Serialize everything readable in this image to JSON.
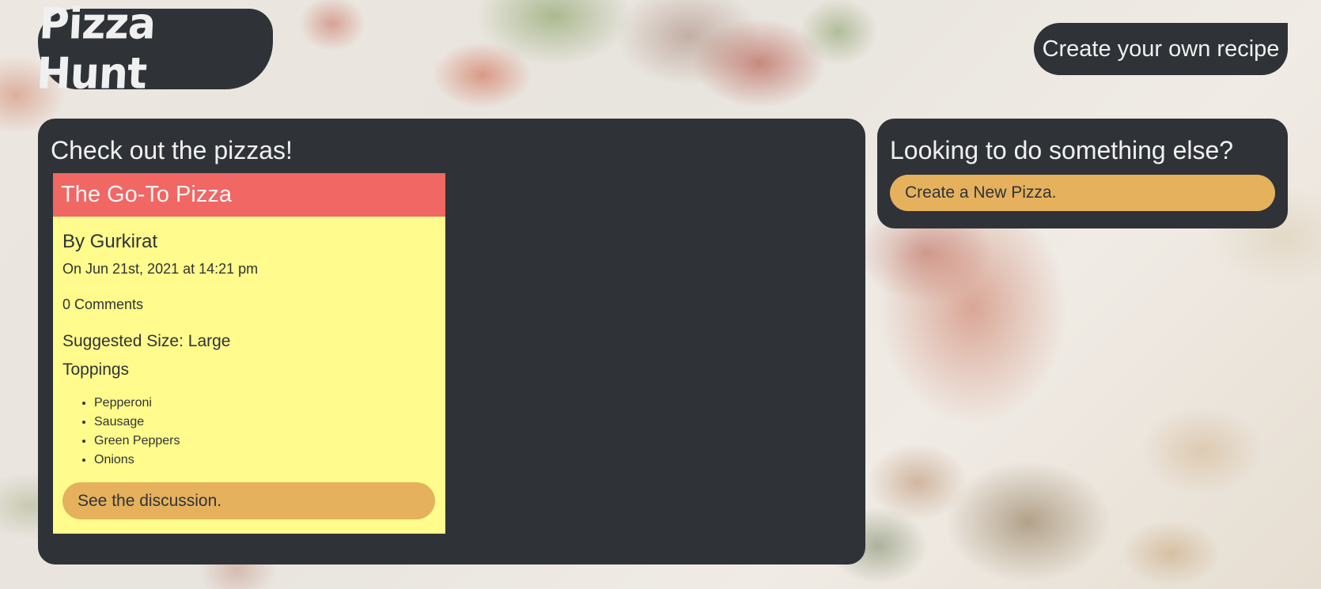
{
  "header": {
    "logo_text": "Pizza Hunt",
    "create_recipe_link": "Create your own recipe"
  },
  "main": {
    "title": "Check out the pizzas!",
    "pizzas": [
      {
        "name": "The Go-To Pizza",
        "author": "By Gurkirat",
        "date": "On Jun 21st, 2021 at 14:21 pm",
        "comments": "0 Comments",
        "suggested_size": "Suggested Size: Large",
        "toppings_title": "Toppings",
        "toppings": [
          "Pepperoni",
          "Sausage",
          "Green Peppers",
          "Onions"
        ],
        "discussion_button": "See the discussion."
      }
    ]
  },
  "sidebar": {
    "title": "Looking to do something else?",
    "new_pizza_button": "Create a New Pizza."
  },
  "colors": {
    "panel": "#2f3337",
    "card_header": "#f06764",
    "card_body": "#fffb8c",
    "button": "#e5b15d",
    "text_light": "#f0f0f0"
  }
}
